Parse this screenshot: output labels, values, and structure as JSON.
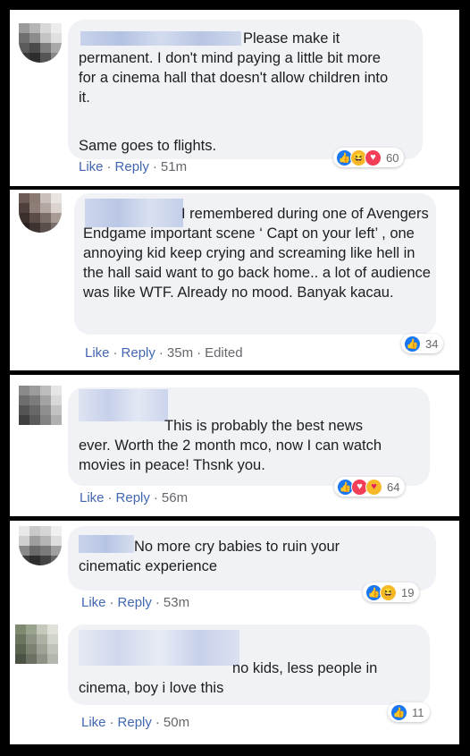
{
  "comments": [
    {
      "text": "Please make it permanent. I don't mind paying a little bit more for a cinema hall that doesn't allow children into it.",
      "text2": "Same goes to flights.",
      "actions": {
        "like": "Like",
        "reply": "Reply",
        "time": "51m"
      },
      "reactions": {
        "icons": [
          "like-icon",
          "haha-icon",
          "love-icon"
        ],
        "count": "60"
      }
    },
    {
      "text": "I remembered during one of Avengers Endgame important scene ‘ Capt on your left’ , one annoying kid keep crying and screaming like hell in the hall said want to go back home.. a lot of audience was like WTF. Already no mood. Banyak kacau.",
      "actions": {
        "like": "Like",
        "reply": "Reply",
        "time": "35m",
        "edited": "Edited"
      },
      "reactions": {
        "icons": [
          "like-icon"
        ],
        "count": "34"
      }
    },
    {
      "text": "This is probably the best news ever. Worth the 2 month mco, now I can watch movies in peace! Thsnk you.",
      "actions": {
        "like": "Like",
        "reply": "Reply",
        "time": "56m"
      },
      "reactions": {
        "icons": [
          "like-icon",
          "love-icon",
          "care-icon"
        ],
        "count": "64"
      }
    },
    {
      "text": "No more cry babies to ruin your cinematic experience",
      "actions": {
        "like": "Like",
        "reply": "Reply",
        "time": "53m"
      },
      "reactions": {
        "icons": [
          "like-icon",
          "haha-icon"
        ],
        "count": "19"
      }
    },
    {
      "text": "no kids, less people in cinema, boy i love this",
      "actions": {
        "like": "Like",
        "reply": "Reply",
        "time": "50m"
      },
      "reactions": {
        "icons": [
          "like-icon"
        ],
        "count": "11"
      }
    }
  ],
  "colors": {
    "link": "#4267b2",
    "bubble": "#f0f2f5",
    "like": "#1877f2",
    "love": "#f33e58",
    "haha": "#f7b928"
  }
}
